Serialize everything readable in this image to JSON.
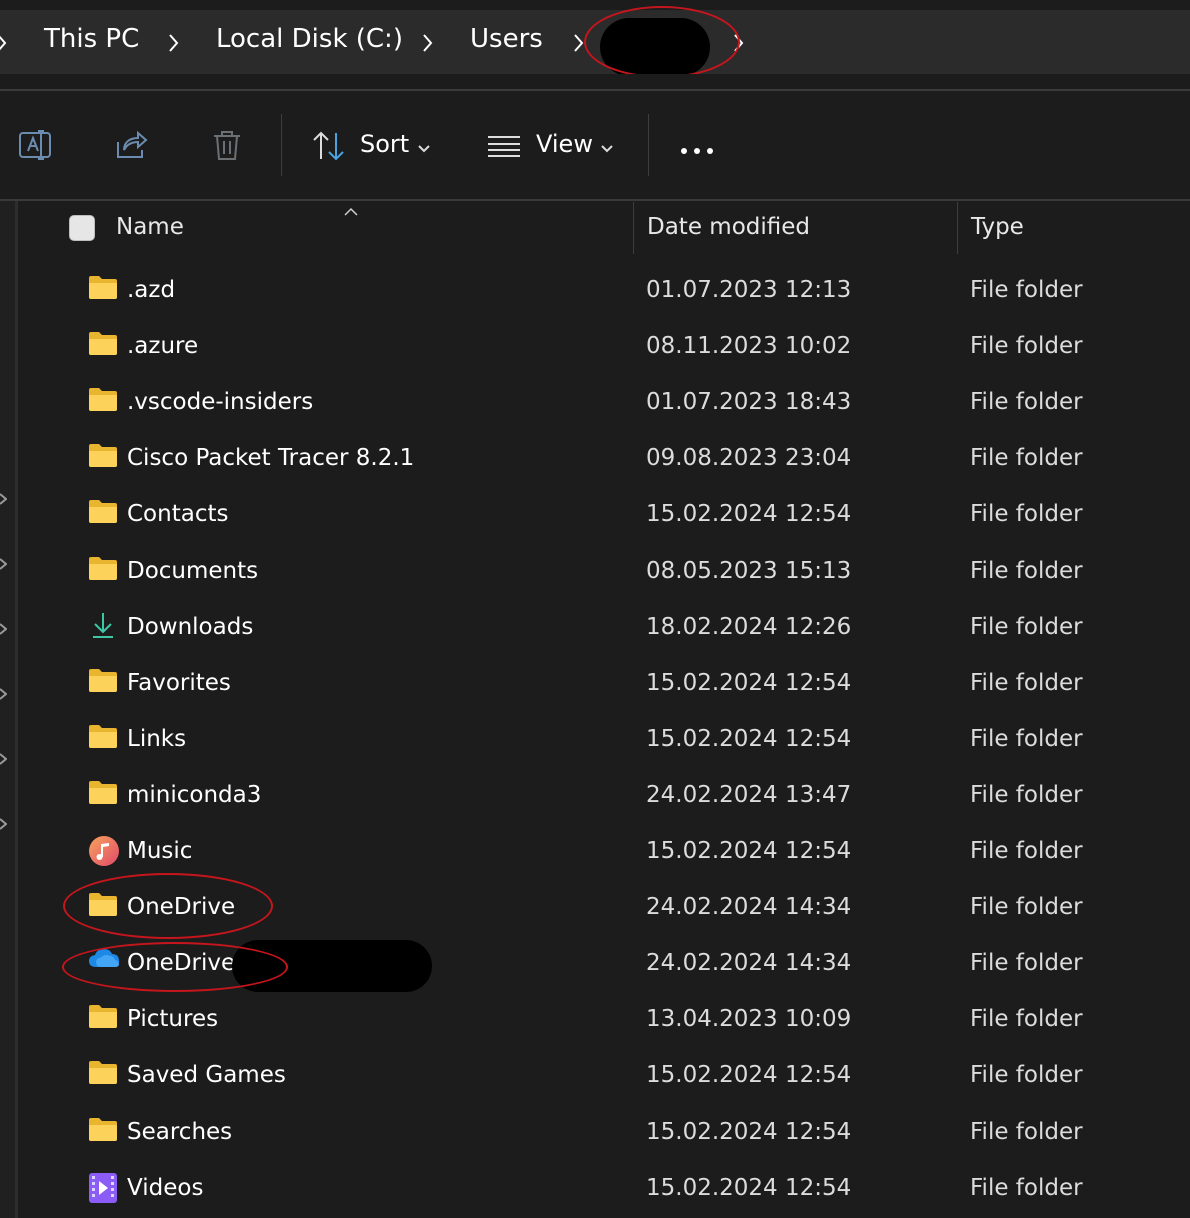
{
  "breadcrumb": {
    "items": [
      "This PC",
      "Local Disk (C:)",
      "Users"
    ]
  },
  "toolbar": {
    "sort_label": "Sort",
    "view_label": "View",
    "icons": [
      "rename-icon",
      "share-icon",
      "delete-icon",
      "sort-icon",
      "view-icon",
      "more-icon"
    ]
  },
  "columns": {
    "name": "Name",
    "date": "Date modified",
    "type": "Type"
  },
  "rows": [
    {
      "name": ".azd",
      "date": "01.07.2023 12:13",
      "type": "File folder",
      "icon": "folder"
    },
    {
      "name": ".azure",
      "date": "08.11.2023 10:02",
      "type": "File folder",
      "icon": "folder"
    },
    {
      "name": ".vscode-insiders",
      "date": "01.07.2023 18:43",
      "type": "File folder",
      "icon": "folder"
    },
    {
      "name": "Cisco Packet Tracer 8.2.1",
      "date": "09.08.2023 23:04",
      "type": "File folder",
      "icon": "folder"
    },
    {
      "name": "Contacts",
      "date": "15.02.2024 12:54",
      "type": "File folder",
      "icon": "folder"
    },
    {
      "name": "Documents",
      "date": "08.05.2023 15:13",
      "type": "File folder",
      "icon": "folder"
    },
    {
      "name": "Downloads",
      "date": "18.02.2024 12:26",
      "type": "File folder",
      "icon": "download"
    },
    {
      "name": "Favorites",
      "date": "15.02.2024 12:54",
      "type": "File folder",
      "icon": "folder"
    },
    {
      "name": "Links",
      "date": "15.02.2024 12:54",
      "type": "File folder",
      "icon": "folder"
    },
    {
      "name": "miniconda3",
      "date": "24.02.2024 13:47",
      "type": "File folder",
      "icon": "folder"
    },
    {
      "name": "Music",
      "date": "15.02.2024 12:54",
      "type": "File folder",
      "icon": "music"
    },
    {
      "name": "OneDrive",
      "date": "24.02.2024 14:34",
      "type": "File folder",
      "icon": "folder"
    },
    {
      "name": "OneDrive",
      "date": "24.02.2024 14:34",
      "type": "File folder",
      "icon": "cloud"
    },
    {
      "name": "Pictures",
      "date": "13.04.2023 10:09",
      "type": "File folder",
      "icon": "folder"
    },
    {
      "name": "Saved Games",
      "date": "15.02.2024 12:54",
      "type": "File folder",
      "icon": "folder"
    },
    {
      "name": "Searches",
      "date": "15.02.2024 12:54",
      "type": "File folder",
      "icon": "folder"
    },
    {
      "name": "Videos",
      "date": "15.02.2024 12:54",
      "type": "File folder",
      "icon": "video"
    }
  ],
  "colors": {
    "background": "#1c1c1c",
    "address_bar": "#2b2b2b",
    "folder_yellow": "#f8c93e",
    "annotation_red": "#c4161c",
    "onedrive_blue": "#1e88e5"
  }
}
